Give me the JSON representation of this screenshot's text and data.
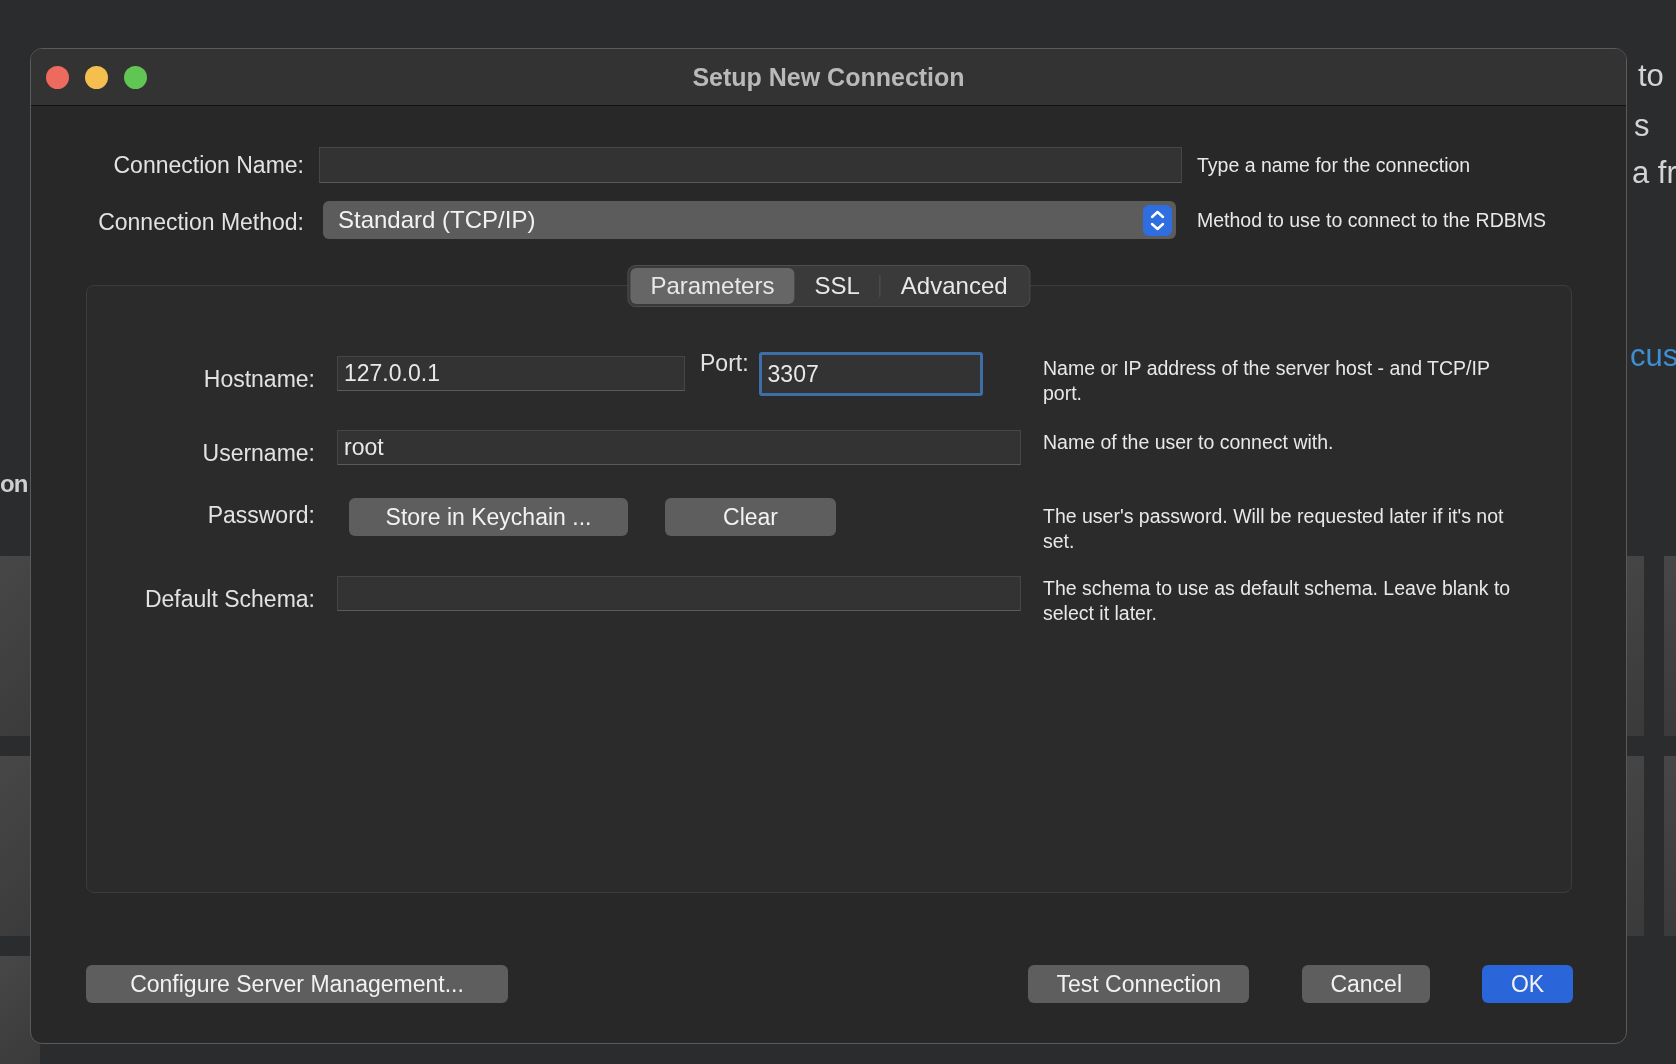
{
  "background": {
    "fragments": [
      {
        "text": "to",
        "kind": "text"
      },
      {
        "text": "s",
        "kind": "text"
      },
      {
        "text": "a fr",
        "kind": "text"
      },
      {
        "text": "cus",
        "kind": "link"
      },
      {
        "text": "on",
        "kind": "heading"
      }
    ]
  },
  "window": {
    "title": "Setup New Connection"
  },
  "connection_name": {
    "label": "Connection Name:",
    "hint": "Type a name for the connection"
  },
  "connection_method": {
    "label": "Connection Method:",
    "value": "Standard (TCP/IP)",
    "hint": "Method to use to connect to the RDBMS"
  },
  "tabs": [
    {
      "label": "Parameters",
      "selected": true
    },
    {
      "label": "SSL",
      "selected": false
    },
    {
      "label": "Advanced",
      "selected": false
    }
  ],
  "parameters": {
    "hostname": {
      "label": "Hostname:",
      "value": "127.0.0.1",
      "focused": false
    },
    "port": {
      "label": "Port:",
      "value": "3307",
      "focused": true
    },
    "host_hint": "Name or IP address of the server host - and TCP/IP port.",
    "username": {
      "label": "Username:",
      "value": "root",
      "hint": "Name of the user to connect with."
    },
    "password": {
      "label": "Password:",
      "buttons": [
        "Store in Keychain ...",
        "Clear"
      ],
      "hint": "The user's password. Will be requested later if it's not set."
    },
    "default_schema": {
      "label": "Default Schema:",
      "hint": "The schema to use as default schema. Leave blank to select it later."
    }
  },
  "buttons": [
    {
      "label": "Configure Server Management...",
      "kind": "left"
    },
    {
      "label": "Test Connection",
      "kind": "normal"
    },
    {
      "label": "Cancel",
      "kind": "normal"
    },
    {
      "label": "OK",
      "kind": "primary"
    }
  ]
}
